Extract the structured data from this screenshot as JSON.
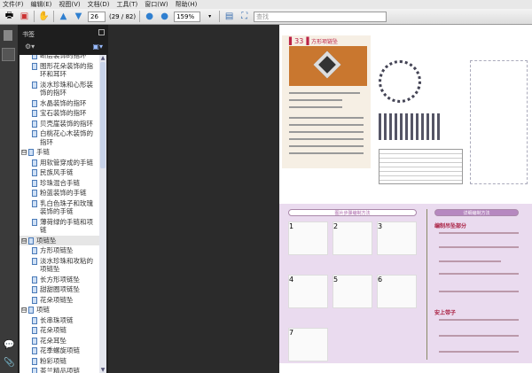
{
  "menu": [
    "文件(F)",
    "编辑(E)",
    "视图(V)",
    "文档(D)",
    "工具(T)",
    "窗口(W)",
    "帮助(H)"
  ],
  "toolbar": {
    "page_input": "26",
    "page_count": "(29 / 82)",
    "zoom": "159%",
    "search_placeholder": "查找"
  },
  "panel": {
    "title": "书签"
  },
  "bookmarks": [
    {
      "level": 2,
      "label": "断层装饰的指环"
    },
    {
      "level": 2,
      "label": "图形花朵装饰的指环和耳环"
    },
    {
      "level": 2,
      "label": "淡水珍珠和心形装饰的指环"
    },
    {
      "level": 2,
      "label": "水晶装饰的指环"
    },
    {
      "level": 2,
      "label": "宝石装饰的指环"
    },
    {
      "level": 2,
      "label": "贝壳崖装饰的指环"
    },
    {
      "level": 2,
      "label": "白桃花心木装饰的指环"
    },
    {
      "level": 1,
      "label": "手链",
      "toggle": "⊟"
    },
    {
      "level": 2,
      "label": "用软管穿成的手链"
    },
    {
      "level": 2,
      "label": "民族风手链"
    },
    {
      "level": 2,
      "label": "珍珠混合手链"
    },
    {
      "level": 2,
      "label": "粉蓝装饰的手链"
    },
    {
      "level": 2,
      "label": "乳白色珠子和玫瑰装饰的手链"
    },
    {
      "level": 2,
      "label": "薄荷绿的手链和项链"
    },
    {
      "level": 1,
      "label": "项链坠",
      "toggle": "⊟",
      "selected": true
    },
    {
      "level": 2,
      "label": "方形项链坠"
    },
    {
      "level": 2,
      "label": "淡水珍珠和攻粘的项链坠"
    },
    {
      "level": 2,
      "label": "长方形项链坠"
    },
    {
      "level": 2,
      "label": "甜甜圈项链坠"
    },
    {
      "level": 2,
      "label": "花朵项链坠"
    },
    {
      "level": 1,
      "label": "项链",
      "toggle": "⊟"
    },
    {
      "level": 2,
      "label": "长串珠项链"
    },
    {
      "level": 2,
      "label": "花朵项链"
    },
    {
      "level": 2,
      "label": "花朵耳坠"
    },
    {
      "level": 2,
      "label": "花季螺旋项链"
    },
    {
      "level": 2,
      "label": "粉彩项链"
    },
    {
      "level": 2,
      "label": "茶兰精品项链"
    }
  ],
  "document": {
    "item_number": "33",
    "item_title": "方形项链坠",
    "section_left": "图片步骤编制方法",
    "section_right": "详细编制方法",
    "step_numbers": [
      "1",
      "2",
      "3",
      "4",
      "5",
      "6",
      "7"
    ],
    "heading1": "编制吊坠部分",
    "heading2": "安上带子"
  }
}
